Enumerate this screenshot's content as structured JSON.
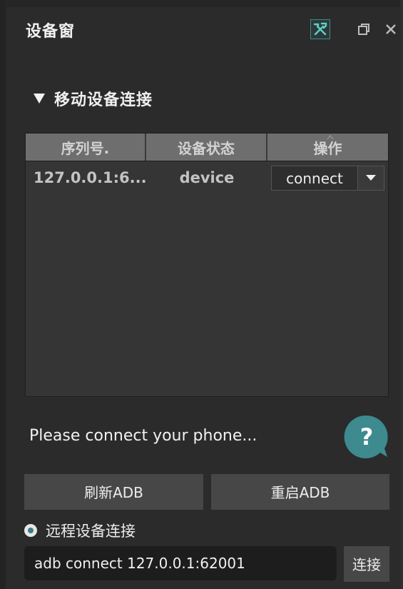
{
  "window": {
    "title": "设备窗"
  },
  "header_icons": {
    "tool": "tools-icon",
    "restore": "restore-icon",
    "close": "close-icon"
  },
  "section": {
    "title": "移动设备连接",
    "expanded": true
  },
  "table": {
    "columns": [
      "序列号.",
      "设备状态",
      "操作"
    ],
    "rows": [
      {
        "serial": "127.0.0.1:6...",
        "status": "device",
        "action": "connect"
      }
    ]
  },
  "status_message": "Please connect your phone...",
  "help": {
    "symbol": "?"
  },
  "buttons": {
    "refresh_adb": "刷新ADB",
    "restart_adb": "重启ADB",
    "connect": "连接"
  },
  "remote": {
    "label": "远程设备连接",
    "selected": true,
    "command_value": "adb connect 127.0.0.1:62001"
  },
  "colors": {
    "background": "#2b2b2b",
    "accent": "#3b7d86",
    "header_bg": "#6e6e6e",
    "button_bg": "#474747"
  }
}
